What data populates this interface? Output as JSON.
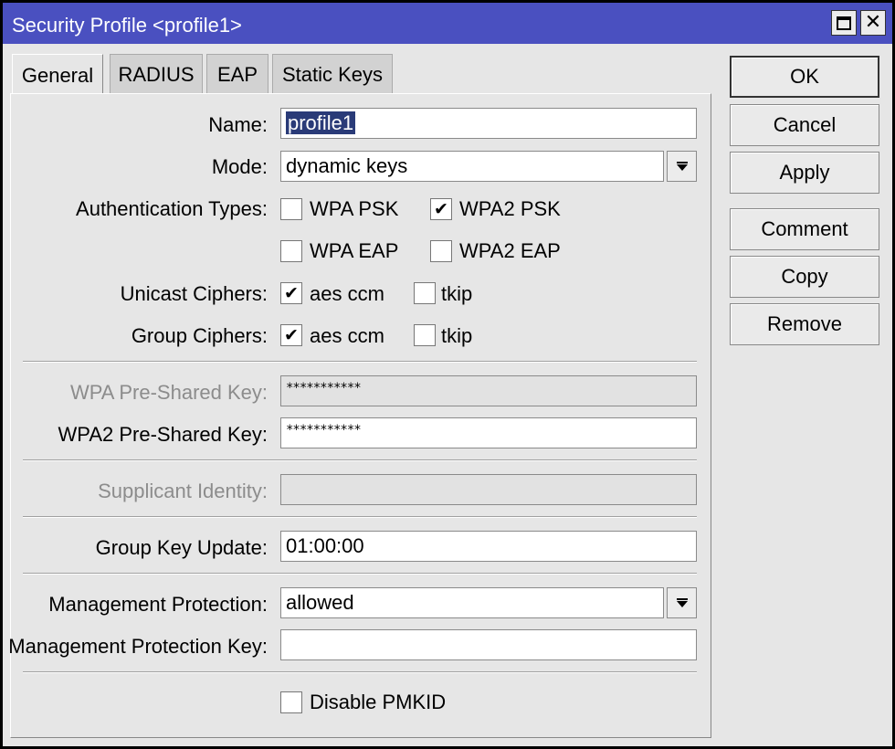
{
  "window": {
    "title": "Security Profile <profile1>",
    "controls": {
      "maximize_icon": "maximize-icon",
      "close_icon": "close-icon",
      "close_glyph": "✕"
    }
  },
  "tabs": [
    {
      "label": "General",
      "active": true
    },
    {
      "label": "RADIUS",
      "active": false
    },
    {
      "label": "EAP",
      "active": false
    },
    {
      "label": "Static Keys",
      "active": false
    }
  ],
  "buttons": {
    "ok": "OK",
    "cancel": "Cancel",
    "apply": "Apply",
    "comment": "Comment",
    "copy": "Copy",
    "remove": "Remove"
  },
  "form": {
    "name": {
      "label": "Name:",
      "value": "profile1"
    },
    "mode": {
      "label": "Mode:",
      "value": "dynamic keys"
    },
    "auth_types": {
      "label": "Authentication Types:",
      "options": [
        {
          "label": "WPA PSK",
          "checked": false
        },
        {
          "label": "WPA2 PSK",
          "checked": true
        },
        {
          "label": "WPA EAP",
          "checked": false
        },
        {
          "label": "WPA2 EAP",
          "checked": false
        }
      ]
    },
    "unicast_ciphers": {
      "label": "Unicast Ciphers:",
      "options": [
        {
          "label": "aes ccm",
          "checked": true
        },
        {
          "label": "tkip",
          "checked": false
        }
      ]
    },
    "group_ciphers": {
      "label": "Group Ciphers:",
      "options": [
        {
          "label": "aes ccm",
          "checked": true
        },
        {
          "label": "tkip",
          "checked": false
        }
      ]
    },
    "wpa_psk": {
      "label": "WPA Pre-Shared Key:",
      "value": "***********",
      "disabled": true
    },
    "wpa2_psk": {
      "label": "WPA2 Pre-Shared Key:",
      "value": "***********"
    },
    "supplicant_identity": {
      "label": "Supplicant Identity:",
      "value": "",
      "disabled": true
    },
    "group_key_update": {
      "label": "Group Key Update:",
      "value": "01:00:00"
    },
    "management_protection": {
      "label": "Management Protection:",
      "value": "allowed"
    },
    "management_protection_key": {
      "label": "Management Protection Key:",
      "value": ""
    },
    "disable_pmkid": {
      "label": "Disable PMKID",
      "checked": false
    }
  },
  "check_glyph": "✔",
  "colors": {
    "titlebar": "#4a50c0",
    "selection": "#2a3b78",
    "panel": "#e6e6e6"
  }
}
